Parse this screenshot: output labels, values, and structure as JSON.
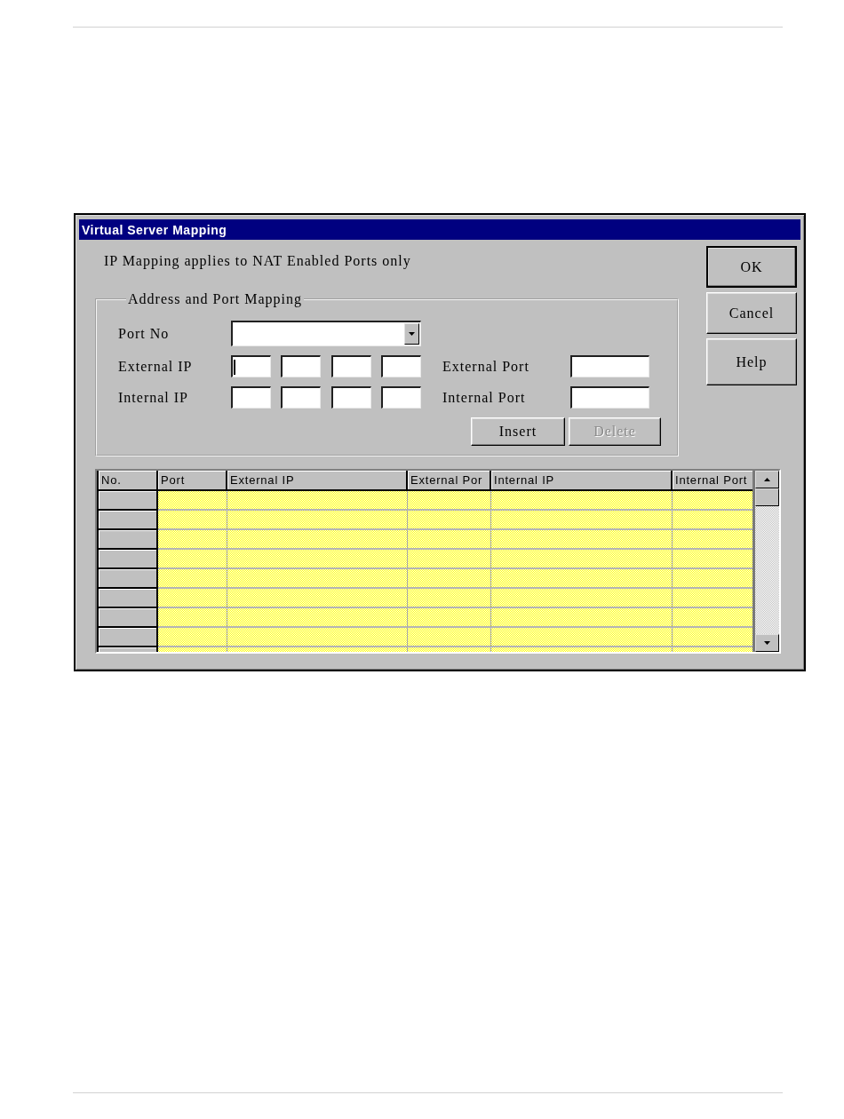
{
  "dialog": {
    "title": "Virtual Server Mapping",
    "note": "IP Mapping applies to NAT Enabled Ports only",
    "side_buttons": [
      {
        "label": "OK",
        "default": true
      },
      {
        "label": "Cancel",
        "default": false
      },
      {
        "label": "Help",
        "default": false
      }
    ],
    "group": {
      "title": "Address and Port Mapping",
      "port_no": {
        "label": "Port No"
      },
      "external_ip": {
        "label": "External IP",
        "octets": [
          {
            "focused": true
          },
          {
            "focused": false
          },
          {
            "focused": false
          },
          {
            "focused": false
          }
        ]
      },
      "internal_ip": {
        "label": "Internal IP",
        "octets": [
          {
            "focused": false
          },
          {
            "focused": false
          },
          {
            "focused": false
          },
          {
            "focused": false
          }
        ]
      },
      "external_port": {
        "label": "External Port"
      },
      "internal_port": {
        "label": "Internal Port"
      },
      "buttons": [
        {
          "label": "Insert",
          "disabled": false
        },
        {
          "label": "Delete",
          "disabled": true
        }
      ]
    },
    "table": {
      "columns": [
        "No.",
        "Port",
        "External IP",
        "External Por",
        "Internal IP",
        "Internal Port"
      ]
    }
  }
}
